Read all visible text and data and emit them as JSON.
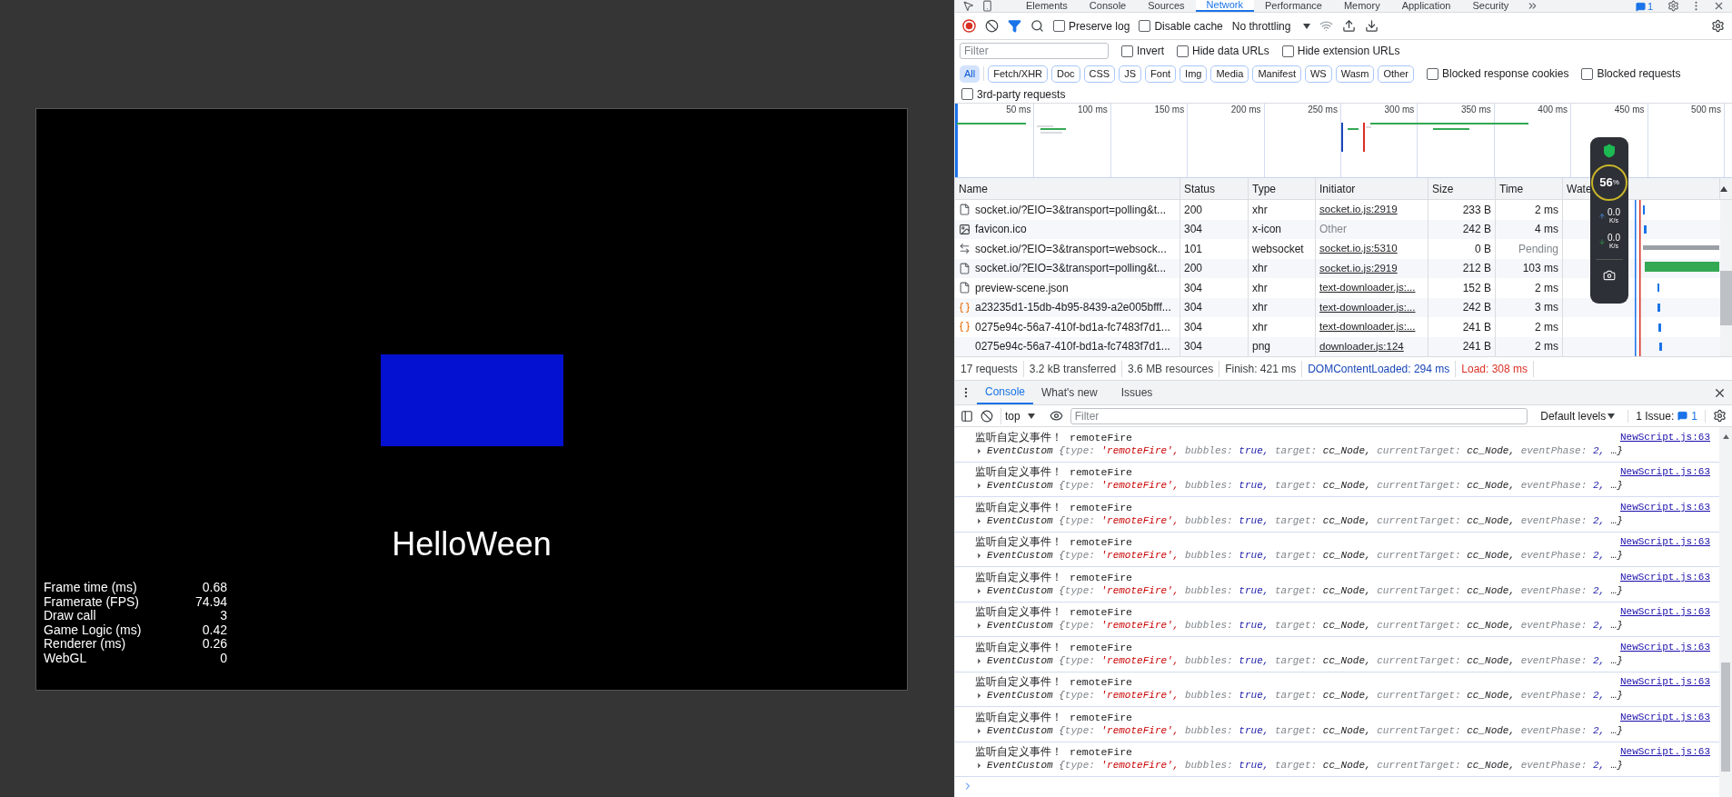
{
  "game_view": {
    "title_text": "HelloWeen",
    "stats": [
      {
        "label": "Frame time (ms)",
        "value": "0.68"
      },
      {
        "label": "Framerate (FPS)",
        "value": "74.94"
      },
      {
        "label": "Draw call",
        "value": "3"
      },
      {
        "label": "Game Logic (ms)",
        "value": "0.42"
      },
      {
        "label": "Renderer (ms)",
        "value": "0.26"
      },
      {
        "label": "WebGL",
        "value": "0"
      }
    ]
  },
  "devtools": {
    "panel_tabs": [
      {
        "label": "Elements",
        "selected": false
      },
      {
        "label": "Console",
        "selected": false
      },
      {
        "label": "Sources",
        "selected": false
      },
      {
        "label": "Network",
        "selected": true
      },
      {
        "label": "Performance",
        "selected": false
      },
      {
        "label": "Memory",
        "selected": false
      },
      {
        "label": "Application",
        "selected": false
      },
      {
        "label": "Security",
        "selected": false
      }
    ],
    "issue_badge": "1",
    "network": {
      "toolbar": {
        "preserve_log": {
          "label": "Preserve log",
          "checked": false
        },
        "disable_cache": {
          "label": "Disable cache",
          "checked": false
        },
        "throttling": "No throttling"
      },
      "filter": {
        "placeholder": "Filter",
        "options": [
          {
            "label": "Invert",
            "checked": false
          },
          {
            "label": "Hide data URLs",
            "checked": false
          },
          {
            "label": "Hide extension URLs",
            "checked": false
          }
        ]
      },
      "type_filters": [
        {
          "label": "All",
          "selected": true
        },
        {
          "label": "Fetch/XHR",
          "selected": false
        },
        {
          "label": "Doc",
          "selected": false
        },
        {
          "label": "CSS",
          "selected": false
        },
        {
          "label": "JS",
          "selected": false
        },
        {
          "label": "Font",
          "selected": false
        },
        {
          "label": "Img",
          "selected": false
        },
        {
          "label": "Media",
          "selected": false
        },
        {
          "label": "Manifest",
          "selected": false
        },
        {
          "label": "WS",
          "selected": false
        },
        {
          "label": "Wasm",
          "selected": false
        },
        {
          "label": "Other",
          "selected": false
        }
      ],
      "extra_filters": [
        {
          "label": "Blocked response cookies",
          "checked": false
        },
        {
          "label": "Blocked requests",
          "checked": false
        }
      ],
      "third_party": {
        "label": "3rd-party requests",
        "checked": false
      },
      "timeline_ticks": [
        "50 ms",
        "100 ms",
        "150 ms",
        "200 ms",
        "250 ms",
        "300 ms",
        "350 ms",
        "400 ms",
        "450 ms",
        "500 ms"
      ],
      "columns": [
        "Name",
        "Status",
        "Type",
        "Initiator",
        "Size",
        "Time",
        "Wate"
      ],
      "rows": [
        {
          "kind": "document",
          "name": "socket.io/?EIO=3&transport=polling&t...",
          "status": "200",
          "type": "xhr",
          "initiator": {
            "text": "socket.io.js:2919",
            "link": true
          },
          "size": "233 B",
          "time": {
            "text": "2 ms",
            "muted": false
          }
        },
        {
          "kind": "favicon",
          "name": "favicon.ico",
          "status": "304",
          "type": "x-icon",
          "initiator": {
            "text": "Other",
            "link": false
          },
          "size": "242 B",
          "time": {
            "text": "4 ms",
            "muted": false
          }
        },
        {
          "kind": "websocket",
          "name": "socket.io/?EIO=3&transport=websock...",
          "status": "101",
          "type": "websocket",
          "initiator": {
            "text": "socket.io.js:5310",
            "link": true
          },
          "size": "0 B",
          "time": {
            "text": "Pending",
            "muted": true
          }
        },
        {
          "kind": "document",
          "name": "socket.io/?EIO=3&transport=polling&t...",
          "status": "200",
          "type": "xhr",
          "initiator": {
            "text": "socket.io.js:2919",
            "link": true
          },
          "size": "212 B",
          "time": {
            "text": "103 ms",
            "muted": false
          }
        },
        {
          "kind": "document",
          "name": "preview-scene.json",
          "status": "304",
          "type": "xhr",
          "initiator": {
            "text": "text-downloader.js:...",
            "link": true
          },
          "size": "152 B",
          "time": {
            "text": "2 ms",
            "muted": false
          }
        },
        {
          "kind": "fetch",
          "name": "a23235d1-15db-4b95-8439-a2e005bfff...",
          "status": "304",
          "type": "xhr",
          "initiator": {
            "text": "text-downloader.js:...",
            "link": true
          },
          "size": "242 B",
          "time": {
            "text": "3 ms",
            "muted": false
          }
        },
        {
          "kind": "fetch",
          "name": "0275e94c-56a7-410f-bd1a-fc7483f7d1...",
          "status": "304",
          "type": "xhr",
          "initiator": {
            "text": "text-downloader.js:...",
            "link": true
          },
          "size": "241 B",
          "time": {
            "text": "2 ms",
            "muted": false
          }
        },
        {
          "kind": "image",
          "name": "0275e94c-56a7-410f-bd1a-fc7483f7d1...",
          "status": "304",
          "type": "png",
          "initiator": {
            "text": "downloader.js:124",
            "link": true
          },
          "size": "241 B",
          "time": {
            "text": "2 ms",
            "muted": false
          }
        }
      ],
      "summary": [
        {
          "text": "17 requests",
          "color": "#3c4043"
        },
        {
          "text": "3.2 kB transferred",
          "color": "#3c4043"
        },
        {
          "text": "3.6 MB resources",
          "color": "#3c4043"
        },
        {
          "text": "Finish: 421 ms",
          "color": "#3c4043"
        },
        {
          "text": "DOMContentLoaded: 294 ms",
          "color": "#1a47b8"
        },
        {
          "text": "Load: 308 ms",
          "color": "#d93025"
        }
      ]
    },
    "speed_widget": {
      "percent": "56",
      "percent_sign": "%",
      "upload": "0.0",
      "upload_unit": "K/s",
      "download": "0.0",
      "download_unit": "K/s"
    },
    "drawer_tabs": [
      {
        "label": "Console",
        "selected": true
      },
      {
        "label": "What's new",
        "selected": false
      },
      {
        "label": "Issues",
        "selected": false
      }
    ],
    "console": {
      "context": "top",
      "filter_placeholder": "Filter",
      "levels": "Default levels",
      "issues_label": "1 Issue:",
      "issues_count": "1",
      "messages": [
        {
          "text": "监听自定义事件！",
          "arg": "remoteFire",
          "source": "NewScript.js:63",
          "object": {
            "class": "EventCustom",
            "open": "{",
            "props": [
              {
                "key": "type:",
                "value": "'remoteFire',",
                "kind": "string"
              },
              {
                "key": "bubbles:",
                "value": "true,",
                "kind": "boolean"
              },
              {
                "key": "target:",
                "value": "cc_Node,",
                "kind": "object"
              },
              {
                "key": "currentTarget:",
                "value": "cc_Node,",
                "kind": "object"
              },
              {
                "key": "eventPhase:",
                "value": "2,",
                "kind": "number"
              }
            ],
            "close": "…}"
          }
        },
        {
          "text": "监听自定义事件！",
          "arg": "remoteFire",
          "source": "NewScript.js:63",
          "object": {
            "class": "EventCustom",
            "open": "{",
            "props": [
              {
                "key": "type:",
                "value": "'remoteFire',",
                "kind": "string"
              },
              {
                "key": "bubbles:",
                "value": "true,",
                "kind": "boolean"
              },
              {
                "key": "target:",
                "value": "cc_Node,",
                "kind": "object"
              },
              {
                "key": "currentTarget:",
                "value": "cc_Node,",
                "kind": "object"
              },
              {
                "key": "eventPhase:",
                "value": "2,",
                "kind": "number"
              }
            ],
            "close": "…}"
          }
        },
        {
          "text": "监听自定义事件！",
          "arg": "remoteFire",
          "source": "NewScript.js:63",
          "object": {
            "class": "EventCustom",
            "open": "{",
            "props": [
              {
                "key": "type:",
                "value": "'remoteFire',",
                "kind": "string"
              },
              {
                "key": "bubbles:",
                "value": "true,",
                "kind": "boolean"
              },
              {
                "key": "target:",
                "value": "cc_Node,",
                "kind": "object"
              },
              {
                "key": "currentTarget:",
                "value": "cc_Node,",
                "kind": "object"
              },
              {
                "key": "eventPhase:",
                "value": "2,",
                "kind": "number"
              }
            ],
            "close": "…}"
          }
        },
        {
          "text": "监听自定义事件！",
          "arg": "remoteFire",
          "source": "NewScript.js:63",
          "object": {
            "class": "EventCustom",
            "open": "{",
            "props": [
              {
                "key": "type:",
                "value": "'remoteFire',",
                "kind": "string"
              },
              {
                "key": "bubbles:",
                "value": "true,",
                "kind": "boolean"
              },
              {
                "key": "target:",
                "value": "cc_Node,",
                "kind": "object"
              },
              {
                "key": "currentTarget:",
                "value": "cc_Node,",
                "kind": "object"
              },
              {
                "key": "eventPhase:",
                "value": "2,",
                "kind": "number"
              }
            ],
            "close": "…}"
          }
        },
        {
          "text": "监听自定义事件！",
          "arg": "remoteFire",
          "source": "NewScript.js:63",
          "object": {
            "class": "EventCustom",
            "open": "{",
            "props": [
              {
                "key": "type:",
                "value": "'remoteFire',",
                "kind": "string"
              },
              {
                "key": "bubbles:",
                "value": "true,",
                "kind": "boolean"
              },
              {
                "key": "target:",
                "value": "cc_Node,",
                "kind": "object"
              },
              {
                "key": "currentTarget:",
                "value": "cc_Node,",
                "kind": "object"
              },
              {
                "key": "eventPhase:",
                "value": "2,",
                "kind": "number"
              }
            ],
            "close": "…}"
          }
        },
        {
          "text": "监听自定义事件！",
          "arg": "remoteFire",
          "source": "NewScript.js:63",
          "object": {
            "class": "EventCustom",
            "open": "{",
            "props": [
              {
                "key": "type:",
                "value": "'remoteFire',",
                "kind": "string"
              },
              {
                "key": "bubbles:",
                "value": "true,",
                "kind": "boolean"
              },
              {
                "key": "target:",
                "value": "cc_Node,",
                "kind": "object"
              },
              {
                "key": "currentTarget:",
                "value": "cc_Node,",
                "kind": "object"
              },
              {
                "key": "eventPhase:",
                "value": "2,",
                "kind": "number"
              }
            ],
            "close": "…}"
          }
        },
        {
          "text": "监听自定义事件！",
          "arg": "remoteFire",
          "source": "NewScript.js:63",
          "object": {
            "class": "EventCustom",
            "open": "{",
            "props": [
              {
                "key": "type:",
                "value": "'remoteFire',",
                "kind": "string"
              },
              {
                "key": "bubbles:",
                "value": "true,",
                "kind": "boolean"
              },
              {
                "key": "target:",
                "value": "cc_Node,",
                "kind": "object"
              },
              {
                "key": "currentTarget:",
                "value": "cc_Node,",
                "kind": "object"
              },
              {
                "key": "eventPhase:",
                "value": "2,",
                "kind": "number"
              }
            ],
            "close": "…}"
          }
        },
        {
          "text": "监听自定义事件！",
          "arg": "remoteFire",
          "source": "NewScript.js:63",
          "object": {
            "class": "EventCustom",
            "open": "{",
            "props": [
              {
                "key": "type:",
                "value": "'remoteFire',",
                "kind": "string"
              },
              {
                "key": "bubbles:",
                "value": "true,",
                "kind": "boolean"
              },
              {
                "key": "target:",
                "value": "cc_Node,",
                "kind": "object"
              },
              {
                "key": "currentTarget:",
                "value": "cc_Node,",
                "kind": "object"
              },
              {
                "key": "eventPhase:",
                "value": "2,",
                "kind": "number"
              }
            ],
            "close": "…}"
          }
        },
        {
          "text": "监听自定义事件！",
          "arg": "remoteFire",
          "source": "NewScript.js:63",
          "object": {
            "class": "EventCustom",
            "open": "{",
            "props": [
              {
                "key": "type:",
                "value": "'remoteFire',",
                "kind": "string"
              },
              {
                "key": "bubbles:",
                "value": "true,",
                "kind": "boolean"
              },
              {
                "key": "target:",
                "value": "cc_Node,",
                "kind": "object"
              },
              {
                "key": "currentTarget:",
                "value": "cc_Node,",
                "kind": "object"
              },
              {
                "key": "eventPhase:",
                "value": "2,",
                "kind": "number"
              }
            ],
            "close": "…}"
          }
        },
        {
          "text": "监听自定义事件！",
          "arg": "remoteFire",
          "source": "NewScript.js:63",
          "object": {
            "class": "EventCustom",
            "open": "{",
            "props": [
              {
                "key": "type:",
                "value": "'remoteFire',",
                "kind": "string"
              },
              {
                "key": "bubbles:",
                "value": "true,",
                "kind": "boolean"
              },
              {
                "key": "target:",
                "value": "cc_Node,",
                "kind": "object"
              },
              {
                "key": "currentTarget:",
                "value": "cc_Node,",
                "kind": "object"
              },
              {
                "key": "eventPhase:",
                "value": "2,",
                "kind": "number"
              }
            ],
            "close": "…}"
          }
        }
      ]
    }
  }
}
